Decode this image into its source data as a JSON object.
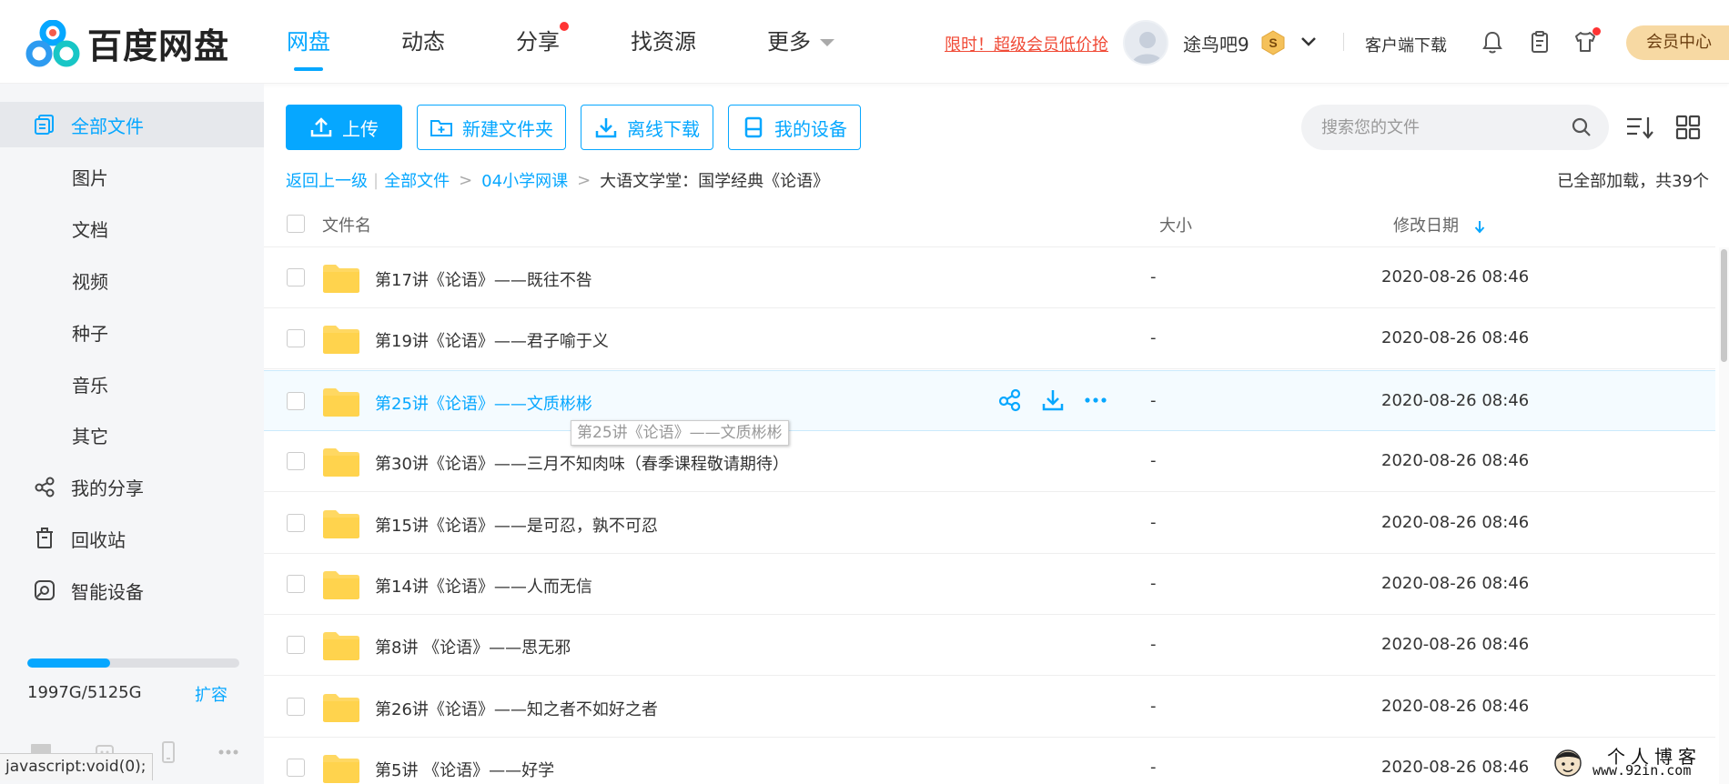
{
  "app": {
    "brand_name": "百度网盘"
  },
  "nav": {
    "items": [
      {
        "label": "网盘"
      },
      {
        "label": "动态"
      },
      {
        "label": "分享"
      },
      {
        "label": "找资源"
      },
      {
        "label": "更多"
      }
    ],
    "active_index": 0
  },
  "header": {
    "promo": "限时！超级会员低价抢",
    "username": "途鸟吧9",
    "vip_badge_letter": "S",
    "client_download": "客户端下载",
    "vip_center": "会员中心"
  },
  "sidebar": {
    "items": [
      {
        "label": "全部文件",
        "icon": "all-files-icon"
      },
      {
        "label": "图片"
      },
      {
        "label": "文档"
      },
      {
        "label": "视频"
      },
      {
        "label": "种子"
      },
      {
        "label": "音乐"
      },
      {
        "label": "其它"
      },
      {
        "label": "我的分享",
        "icon": "share-icon"
      },
      {
        "label": "回收站",
        "icon": "trash-icon"
      },
      {
        "label": "智能设备",
        "icon": "smart-device-icon"
      }
    ],
    "quota": {
      "used_fraction": 0.39,
      "text": "1997G/5125G",
      "expand_label": "扩容"
    },
    "status_url": "javascript:void(0);"
  },
  "toolbar": {
    "upload_label": "上传",
    "new_folder_label": "新建文件夹",
    "offline_download_label": "离线下载",
    "my_devices_label": "我的设备",
    "search_placeholder": "搜索您的文件"
  },
  "breadcrumb": {
    "back_label": "返回上一级",
    "separator": "|",
    "crumbs": [
      "全部文件",
      "04小学网课"
    ],
    "gt": ">",
    "current": "大语文学堂：国学经典《论语》",
    "load_info": "已全部加载，共39个"
  },
  "table": {
    "headers": {
      "name": "文件名",
      "size": "大小",
      "date": "修改日期"
    },
    "rows": [
      {
        "name": "第17讲《论语》——既往不咎",
        "size": "-",
        "date": "2020-08-26 08:46"
      },
      {
        "name": "第19讲《论语》——君子喻于义",
        "size": "-",
        "date": "2020-08-26 08:46"
      },
      {
        "name": "第25讲《论语》——文质彬彬",
        "size": "-",
        "date": "2020-08-26 08:46"
      },
      {
        "name": "第30讲《论语》——三月不知肉味（春季课程敬请期待）",
        "size": "-",
        "date": "2020-08-26 08:46"
      },
      {
        "name": "第15讲《论语》——是可忍，孰不可忍",
        "size": "-",
        "date": "2020-08-26 08:46"
      },
      {
        "name": "第14讲《论语》——人而无信",
        "size": "-",
        "date": "2020-08-26 08:46"
      },
      {
        "name": "第8讲 《论语》——思无邪",
        "size": "-",
        "date": "2020-08-26 08:46"
      },
      {
        "name": "第26讲《论语》——知之者不如好之者",
        "size": "-",
        "date": "2020-08-26 08:46"
      },
      {
        "name": "第5讲 《论语》——好学",
        "size": "-",
        "date": "2020-08-26 08:46"
      }
    ],
    "hover_row_index": 2,
    "tooltip": "第25讲《论语》——文质彬彬"
  },
  "watermark": {
    "title": "个人博客",
    "url": "www.92in.com"
  },
  "colors": {
    "accent": "#06a7ff",
    "promo": "#f04a36",
    "folder": "#ffd862",
    "vip_gold": "#f7d9a3"
  }
}
